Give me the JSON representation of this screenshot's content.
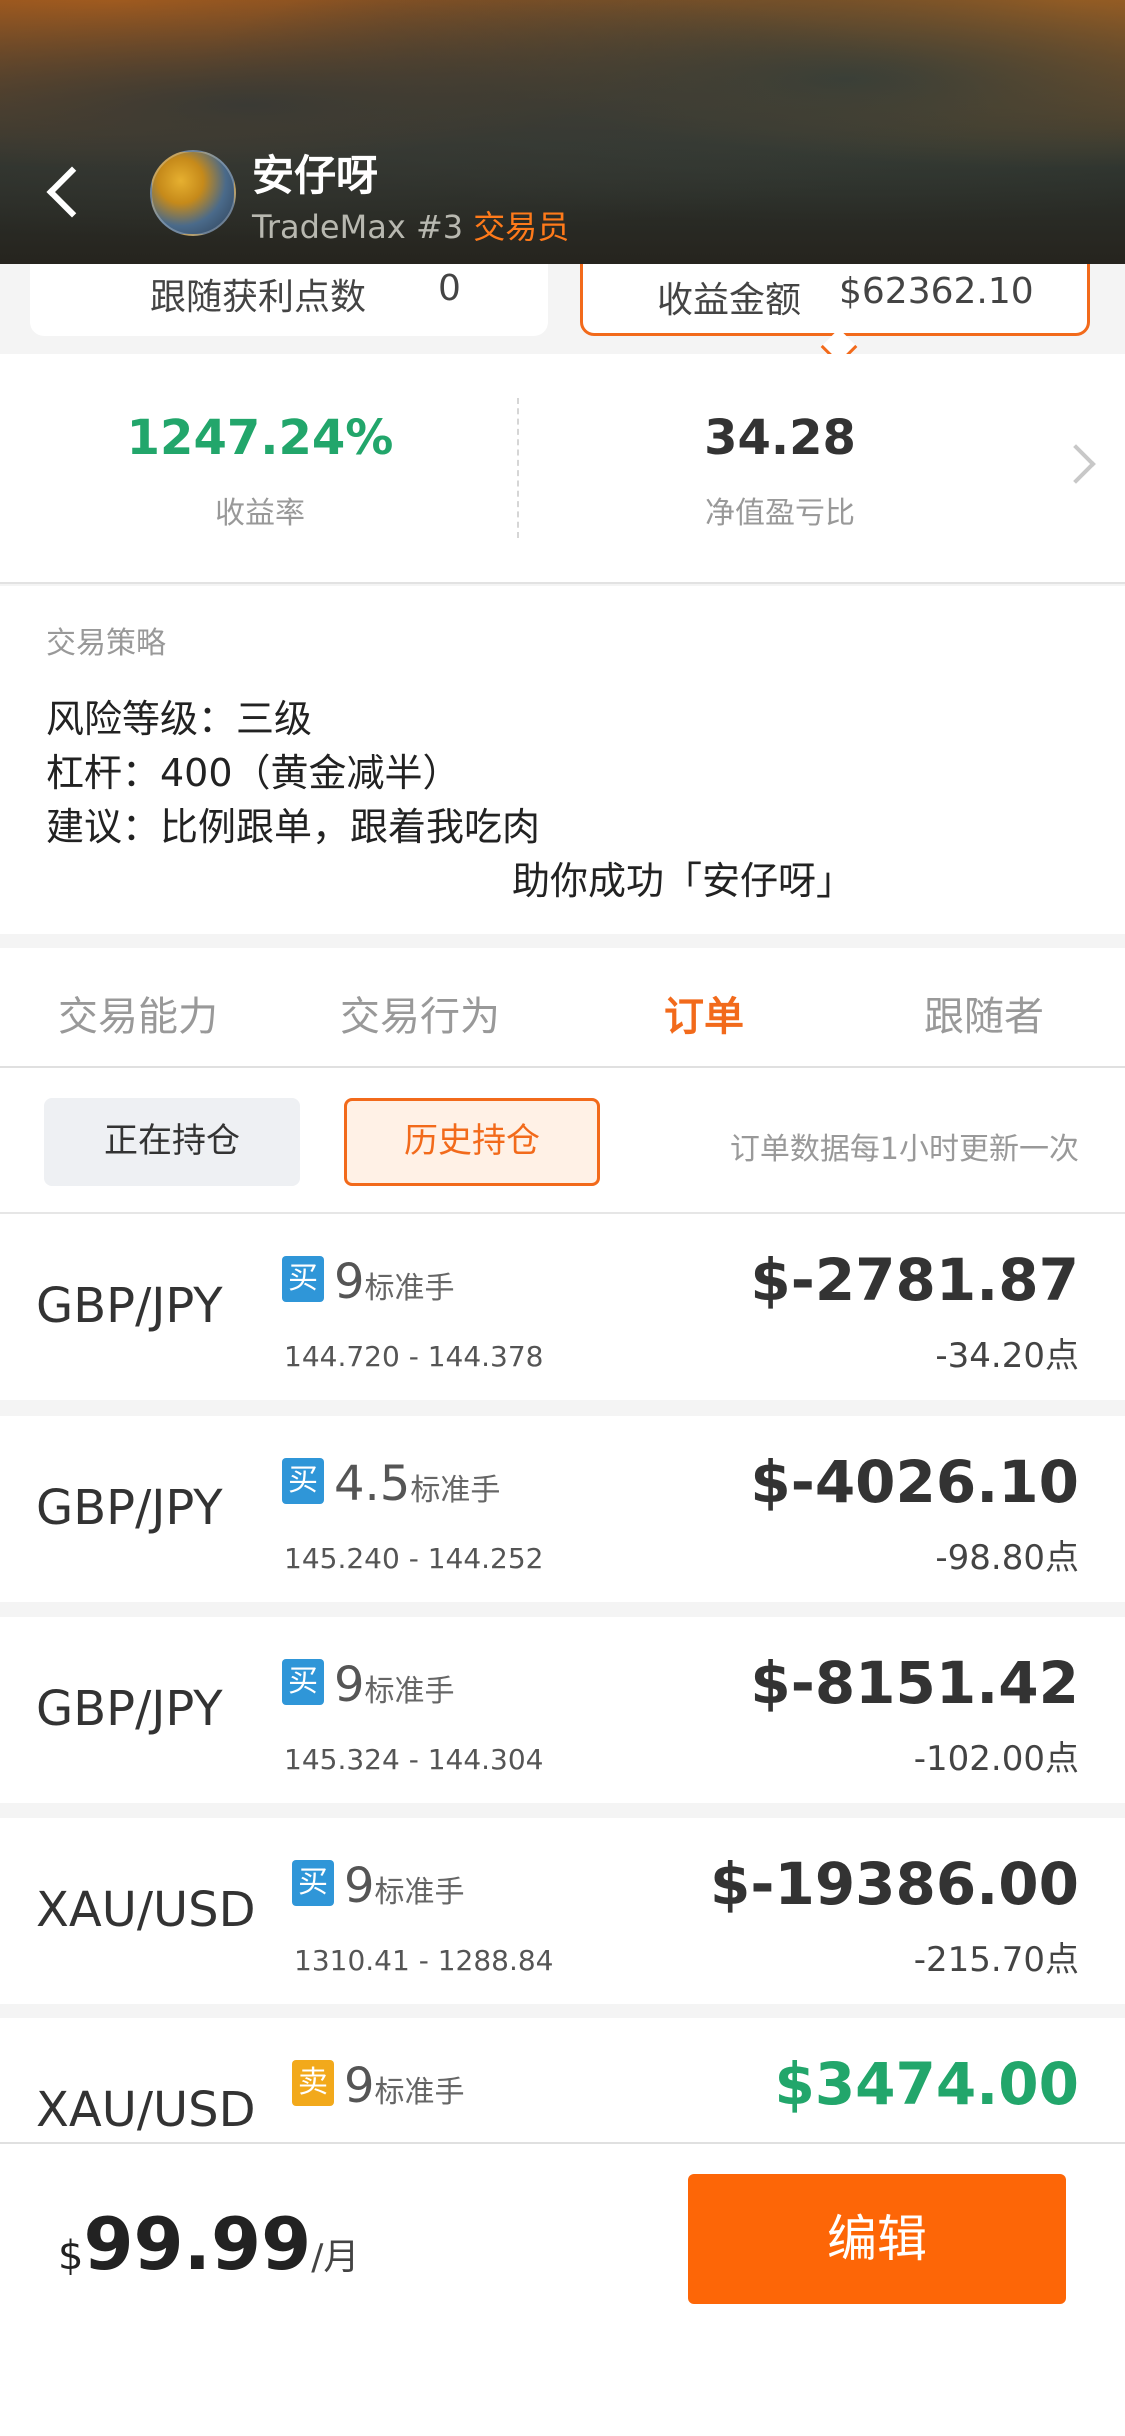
{
  "header": {
    "trader_name": "安仔呀",
    "platform": "TradeMax #3",
    "role": "交易员"
  },
  "summary": {
    "follow_points_label": "跟随获利点数",
    "follow_points_value": "0",
    "profit_amount_label": "收益金额",
    "profit_amount_value": "$62362.10"
  },
  "stats": {
    "return_rate": "1247.24%",
    "return_rate_label": "收益率",
    "equity_ratio": "34.28",
    "equity_ratio_label": "净值盈亏比"
  },
  "strategy": {
    "title": "交易策略",
    "lines": [
      "风险等级：三级",
      "杠杆：400（黄金减半）",
      "建议：比例跟单，跟着我吃肉",
      "助你成功「安仔呀」"
    ]
  },
  "tabs": [
    {
      "label": "交易能力",
      "active": false
    },
    {
      "label": "交易行为",
      "active": false
    },
    {
      "label": "订单",
      "active": true
    },
    {
      "label": "跟随者",
      "active": false
    }
  ],
  "subbar": {
    "open_positions": "正在持仓",
    "history_positions": "历史持仓",
    "note": "订单数据每1小时更新一次"
  },
  "orders": [
    {
      "pair": "GBP/JPY",
      "side": "买",
      "lots": "9",
      "unit": "标准手",
      "range": "144.720 - 144.378",
      "pnl": "$-2781.87",
      "points": "-34.20",
      "points_unit": "点"
    },
    {
      "pair": "GBP/JPY",
      "side": "买",
      "lots": "4.5",
      "unit": "标准手",
      "range": "145.240 - 144.252",
      "pnl": "$-4026.10",
      "points": "-98.80",
      "points_unit": "点"
    },
    {
      "pair": "GBP/JPY",
      "side": "买",
      "lots": "9",
      "unit": "标准手",
      "range": "145.324 - 144.304",
      "pnl": "$-8151.42",
      "points": "-102.00",
      "points_unit": "点"
    },
    {
      "pair": "XAU/USD",
      "side": "买",
      "lots": "9",
      "unit": "标准手",
      "range": "1310.41 - 1288.84",
      "pnl": "$-19386.00",
      "points": "-215.70",
      "points_unit": "点"
    },
    {
      "pair": "XAU/USD",
      "side": "卖",
      "lots": "9",
      "unit": "标准手",
      "pnl": "$3474.00"
    }
  ],
  "bottom": {
    "currency": "$",
    "price": "99.99",
    "period": "/月",
    "edit_label": "编辑"
  },
  "colors": {
    "accent": "#f26a1b",
    "positive": "#22a66b",
    "buy_badge": "#2f96d8",
    "sell_badge": "#f2a91b",
    "edit_button": "#fd6607"
  }
}
